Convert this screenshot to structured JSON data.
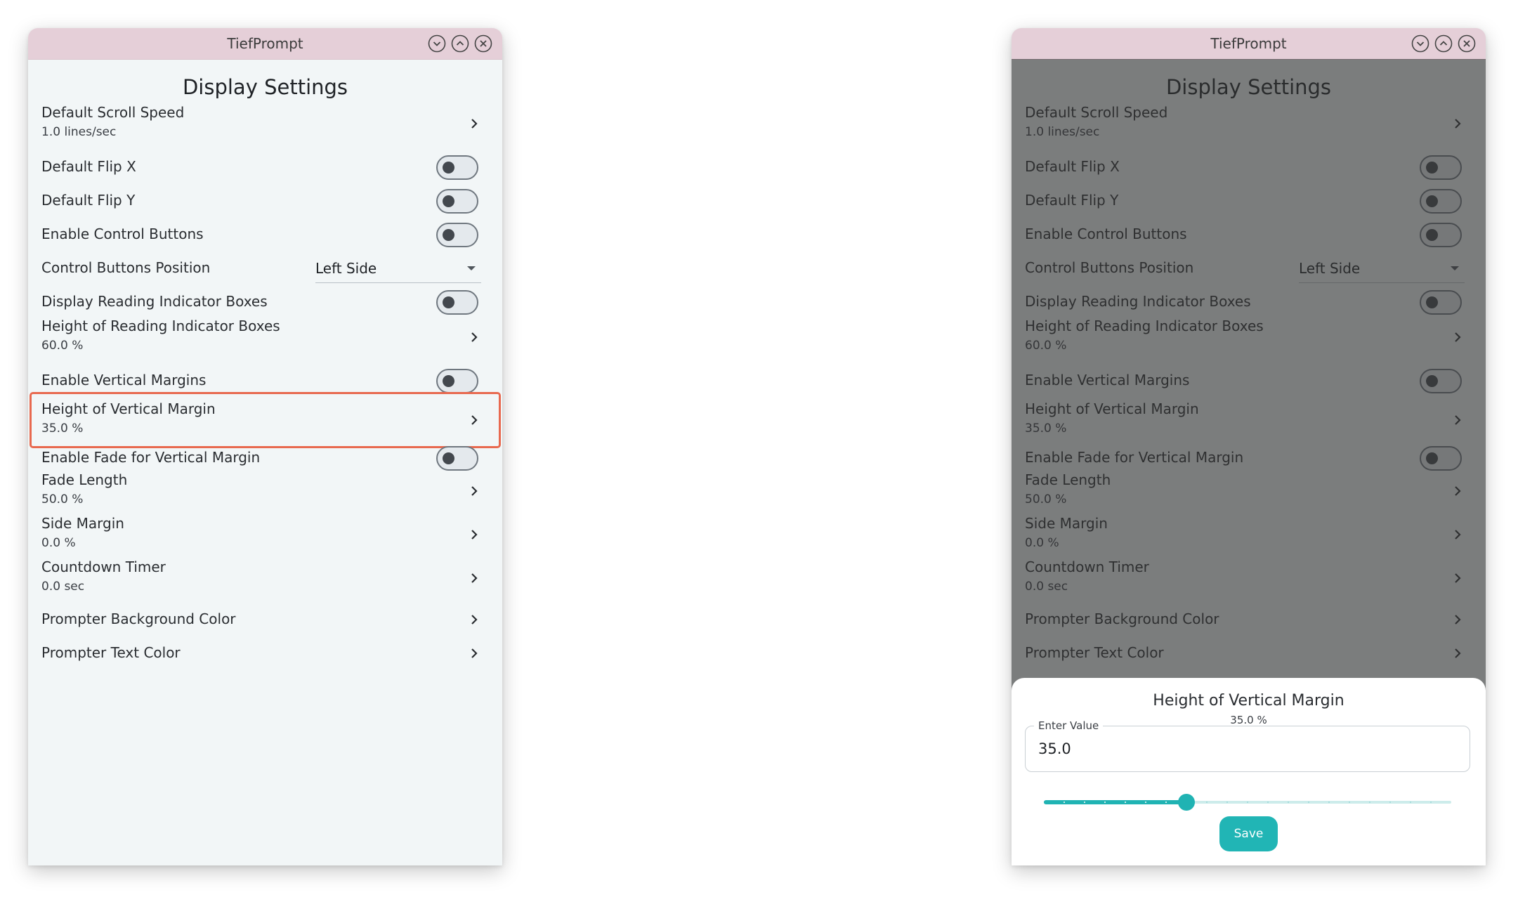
{
  "app": {
    "title": "TiefPrompt",
    "heading": "Display Settings",
    "window_controls": [
      "minimize-icon",
      "maximize-icon",
      "close-icon"
    ]
  },
  "settings": [
    {
      "label": "Default Scroll Speed",
      "value": "1.0 lines/sec",
      "type": "nav"
    },
    {
      "label": "Default Flip X",
      "type": "toggle",
      "checked": false
    },
    {
      "label": "Default Flip Y",
      "type": "toggle",
      "checked": false
    },
    {
      "label": "Enable Control Buttons",
      "type": "toggle",
      "checked": false
    },
    {
      "label": "Control Buttons Position",
      "type": "select",
      "value": "Left Side"
    },
    {
      "label": "Display Reading Indicator Boxes",
      "type": "toggle",
      "checked": false
    },
    {
      "label": "Height of Reading Indicator Boxes",
      "value": "60.0 %",
      "type": "nav"
    },
    {
      "label": "Enable Vertical Margins",
      "type": "toggle",
      "checked": false
    },
    {
      "label": "Height of Vertical Margin",
      "value": "35.0 %",
      "type": "nav",
      "highlighted": true
    },
    {
      "label": "Enable Fade for Vertical Margin",
      "type": "toggle",
      "checked": false
    },
    {
      "label": "Fade Length",
      "value": "50.0 %",
      "type": "nav"
    },
    {
      "label": "Side Margin",
      "value": "0.0 %",
      "type": "nav"
    },
    {
      "label": "Countdown Timer",
      "value": "0.0 sec",
      "type": "nav"
    },
    {
      "label": "Prompter Background Color",
      "type": "nav"
    },
    {
      "label": "Prompter Text Color",
      "type": "nav"
    }
  ],
  "dialog": {
    "title": "Height of Vertical Margin",
    "current_value": "35.0 %",
    "input_label": "Enter Value",
    "input_value": "35.0",
    "slider_fraction": 0.35,
    "slider_steps": 20,
    "save_label": "Save"
  },
  "colors": {
    "accent": "#21b5b5",
    "titlebar": "#e5cfd8",
    "background": "#f2f6f7",
    "highlight": "#e8694f"
  }
}
